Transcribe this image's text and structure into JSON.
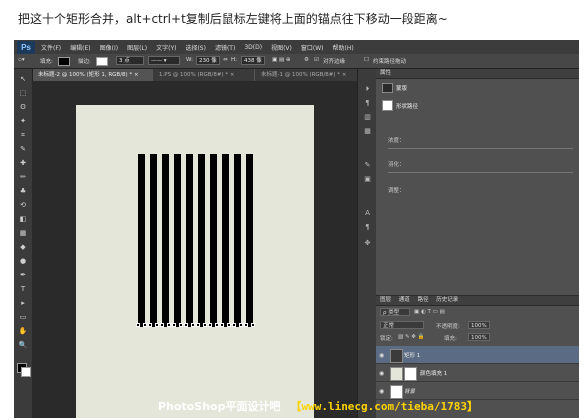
{
  "caption": "把这十个矩形合并，alt+ctrl+t复制后鼠标左键将上面的锚点往下移动一段距离~",
  "app": {
    "logo": "Ps",
    "menu": [
      "文件(F)",
      "编辑(E)",
      "图像(I)",
      "图层(L)",
      "文字(Y)",
      "选择(S)",
      "滤镜(T)",
      "3D(D)",
      "视图(V)",
      "窗口(W)",
      "帮助(H)"
    ]
  },
  "options": {
    "fill_label": "填充:",
    "stroke_label": "描边:",
    "stroke_size": "3 点",
    "w_label": "W:",
    "w_value": "230 像",
    "h_label": "H:",
    "h_value": "438 像",
    "align_edges_label": "对齐边缘",
    "constrain_label": "约束路径拖动",
    "fill_color": "#000000",
    "stroke_color": "#ffffff"
  },
  "tabs": [
    {
      "label": "未标题-2 @ 100% (矩形 1, RGB/8) *",
      "close": "×"
    },
    {
      "label": "1.PS @ 100% (RGB/8#) *",
      "close": "×"
    },
    {
      "label": "未标题-1 @ 100% (RGB/8#) *",
      "close": "×"
    }
  ],
  "tools": [
    "move-icon",
    "marquee-icon",
    "lasso-icon",
    "quick-select-icon",
    "crop-icon",
    "eyedropper-icon",
    "healing-icon",
    "brush-icon",
    "stamp-icon",
    "history-brush-icon",
    "eraser-icon",
    "gradient-icon",
    "blur-icon",
    "dodge-icon",
    "pen-icon",
    "type-icon",
    "path-select-icon",
    "shape-icon",
    "hand-icon",
    "zoom-icon"
  ],
  "tool_glyphs": [
    "↖",
    "⬚",
    "ʘ",
    "✦",
    "⌗",
    "✎",
    "✚",
    "✏",
    "♣",
    "⟲",
    "◧",
    "▦",
    "◆",
    "●",
    "✒",
    "T",
    "▸",
    "▭",
    "✋",
    "🔍"
  ],
  "properties": {
    "title": "属性",
    "item1": "蒙版",
    "item2": "形状路径",
    "density_label": "浓度：",
    "feather_label": "羽化：",
    "adjust_label": "调整："
  },
  "layers": {
    "tabs": [
      "图层",
      "通道",
      "路径",
      "历史记录"
    ],
    "kind_select": "ρ 类型",
    "blend_mode": "正常",
    "opacity_label": "不透明度:",
    "opacity_value": "100%",
    "lock_label": "锁定:",
    "fill_label": "填充:",
    "fill_value": "100%",
    "items": [
      {
        "name": "矩形 1",
        "selected": true
      },
      {
        "name": "颜色填充 1",
        "selected": false
      },
      {
        "name": "背景",
        "selected": false
      }
    ]
  },
  "watermark": {
    "left": "PhotoShop平面设计吧",
    "right": "【www.linecg.com/tieba/1783】"
  }
}
